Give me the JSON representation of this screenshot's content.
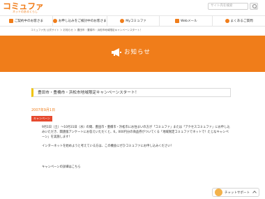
{
  "header": {
    "logo_main": "コミュファ",
    "logo_sub": "ネットのあるくらし",
    "search_placeholder": "サイト内を検索"
  },
  "nav": {
    "items": [
      {
        "label": "ご契約中のお客さま",
        "icon": "doc-icon"
      },
      {
        "label": "お申し込みをご検討中のお客さま",
        "icon": "house-icon"
      },
      {
        "label": "Myコミュファ",
        "icon": "gear-icon"
      },
      {
        "label": "Webメール",
        "icon": "mail-icon"
      },
      {
        "label": "よくあるご質問",
        "icon": "question-icon"
      }
    ]
  },
  "breadcrumb": "コミュファ光 公式サイト ＞ お知らせ ＞ 豊田市・豊橋市・浜松市地域限定キャンペーンスタート！",
  "band": {
    "title": "お知らせ",
    "icon": "megaphone-icon",
    "color": "#f07d1a"
  },
  "notice": {
    "title": "豊田市・豊橋市・浜松市地域限定キャンペーンスタート！",
    "date": "2007年9月1日",
    "tag": "キャンペーン",
    "paragraphs": [
      "9月1日（土）～10月31日（水）の間、豊田市・豊橋市・浜松市にお住まいの方が「コミュファ」または「アクセスコミュファ」にお申し込みいただき、関連版アンケートにお答えいただくと、6，000円分の商品券がついてくる「地域限定コミュファでネットで！たじなキャンペーン」を実施します！",
      "インターネットを始めようと考えている方は、この機会にぜひコミュファにお申し込みください！"
    ],
    "more_link": "キャンペーンの詳細はこちら"
  },
  "chat": {
    "label": "チャットサポート"
  }
}
